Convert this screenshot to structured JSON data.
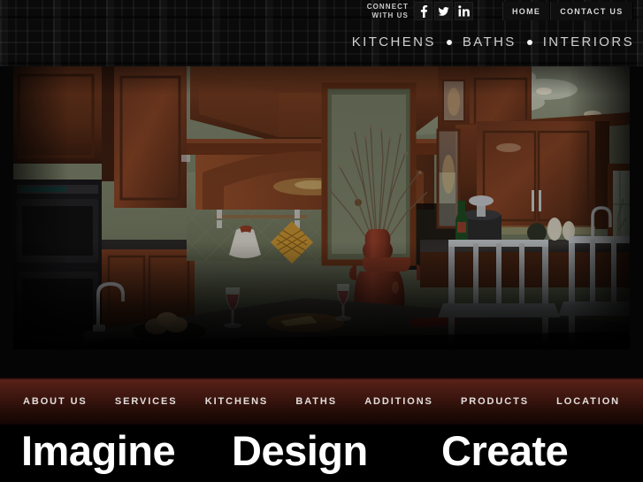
{
  "header": {
    "connect_label": "CONNECT WITH US",
    "connect_line1": "CONNECT",
    "connect_line2": "WITH US",
    "social": [
      {
        "name": "facebook-icon",
        "label": "f"
      },
      {
        "name": "twitter-icon",
        "label": "t"
      },
      {
        "name": "linkedin-icon",
        "label": "in"
      }
    ],
    "top_nav": [
      {
        "label": "HOME"
      },
      {
        "label": "CONTACT US"
      }
    ],
    "tagline": {
      "item1": "KITCHENS",
      "item2": "BATHS",
      "item3": "INTERIORS"
    }
  },
  "hero": {
    "alt": "Traditional kitchen interior with cherry wood cabinets, arched wood range hood, tile backsplash, sage green walls, tall terracotta vase with branches, dark granite island with bar stools, wine bottle and glasses"
  },
  "navbar": {
    "items": [
      {
        "label": "ABOUT US"
      },
      {
        "label": "SERVICES"
      },
      {
        "label": "KITCHENS"
      },
      {
        "label": "BATHS"
      },
      {
        "label": "ADDITIONS"
      },
      {
        "label": "PRODUCTS"
      },
      {
        "label": "LOCATION"
      }
    ]
  },
  "headline": {
    "word1": "Imagine",
    "word2": "Design",
    "word3": "Create"
  },
  "colors": {
    "nav_accent": "#5a2218",
    "header_bg": "#0a0a0a",
    "text_light": "#e2dedc",
    "page_bg": "#000000"
  }
}
